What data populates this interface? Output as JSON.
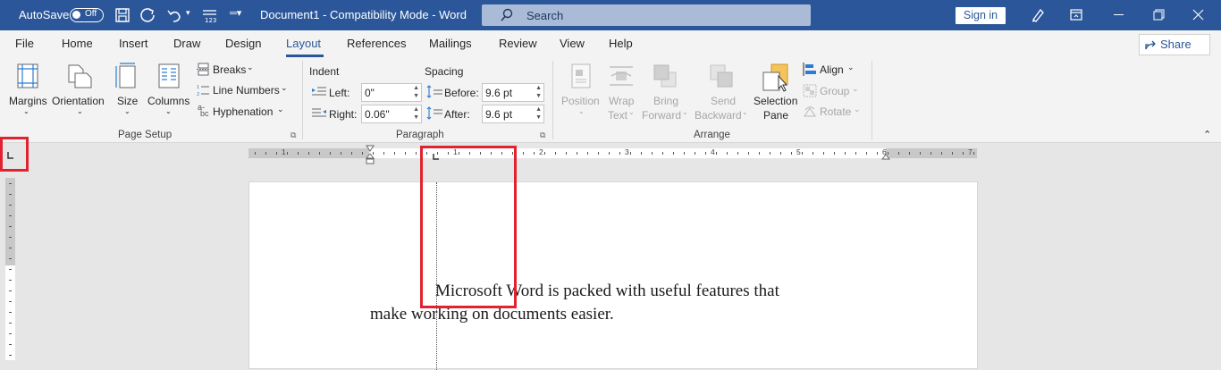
{
  "titlebar": {
    "autosave_label": "AutoSave",
    "autosave_state": "Off",
    "document_title": "Document1  -  Compatibility Mode  -  Word",
    "search_placeholder": "Search",
    "signin_label": "Sign in"
  },
  "tabs": {
    "items": [
      "File",
      "Home",
      "Insert",
      "Draw",
      "Design",
      "Layout",
      "References",
      "Mailings",
      "Review",
      "View",
      "Help"
    ],
    "active": "Layout",
    "share_label": "Share"
  },
  "ribbon": {
    "page_setup": {
      "margins": "Margins",
      "orientation": "Orientation",
      "size": "Size",
      "columns": "Columns",
      "breaks": "Breaks",
      "line_numbers": "Line Numbers",
      "hyphenation": "Hyphenation",
      "group_label": "Page Setup"
    },
    "paragraph": {
      "indent_label": "Indent",
      "left_label": "Left:",
      "left_value": "0\"",
      "right_label": "Right:",
      "right_value": "0.06\"",
      "spacing_label": "Spacing",
      "before_label": "Before:",
      "before_value": "9.6 pt",
      "after_label": "After:",
      "after_value": "9.6 pt",
      "group_label": "Paragraph"
    },
    "arrange": {
      "position": "Position",
      "wrap_text_1": "Wrap",
      "wrap_text_2": "Text",
      "bring_forward_1": "Bring",
      "bring_forward_2": "Forward",
      "send_backward_1": "Send",
      "send_backward_2": "Backward",
      "selection_pane_1": "Selection",
      "selection_pane_2": "Pane",
      "align": "Align",
      "group": "Group",
      "rotate": "Rotate",
      "group_label": "Arrange"
    }
  },
  "ruler": {
    "numbers": [
      "1",
      "1",
      "2",
      "3",
      "4",
      "5",
      "6",
      "7"
    ]
  },
  "document": {
    "line1": "Microsoft Word is packed with useful features that",
    "line2": "make working on documents easier."
  },
  "colors": {
    "titlebar": "#2b579a",
    "highlight": "#e0232e"
  }
}
